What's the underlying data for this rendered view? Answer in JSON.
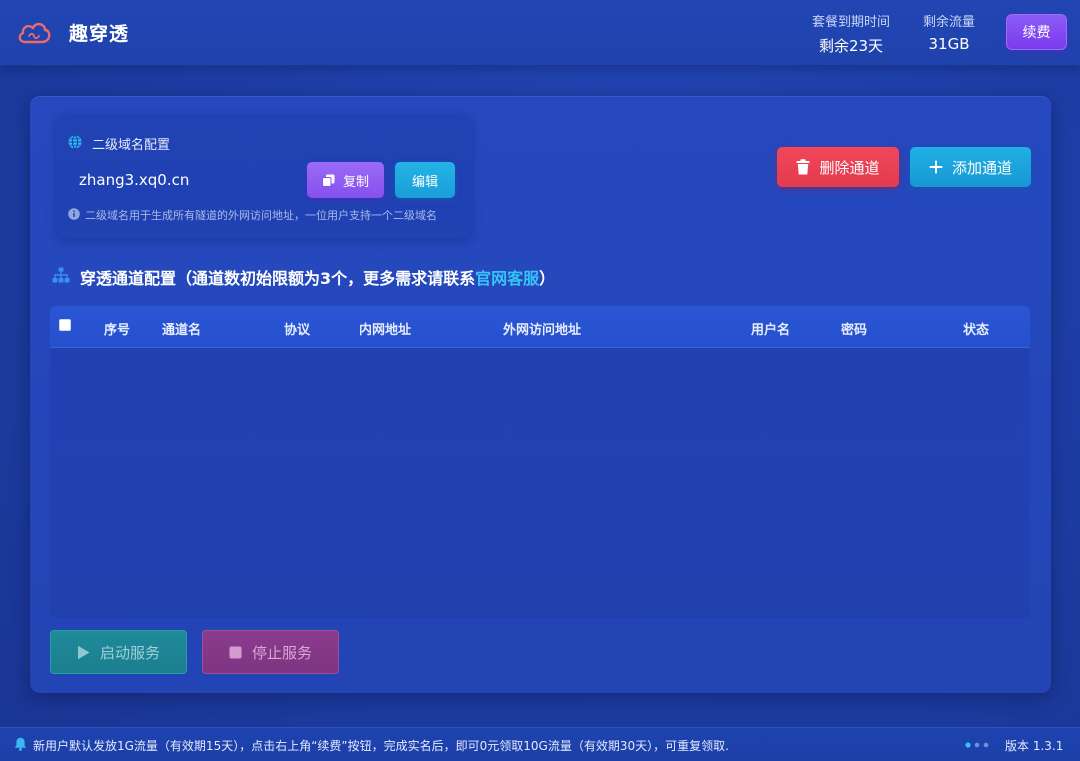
{
  "header": {
    "app_title": "趣穿透",
    "expire": {
      "label": "套餐到期时间",
      "value": "剩余23天"
    },
    "traffic": {
      "label": "剩余流量",
      "value": "31GB"
    },
    "renew_label": "续费"
  },
  "domain": {
    "title": "二级域名配置",
    "value": "zhang3.xq0.cn",
    "copy_label": "复制",
    "edit_label": "编辑",
    "note": "二级域名用于生成所有隧道的外网访问地址，一位用户支持一个二级域名"
  },
  "actions": {
    "delete_label": "删除通道",
    "add_label": "添加通道"
  },
  "section": {
    "title_prefix": "穿透通道配置（通道数初始限额为3个，更多需求请联系",
    "link_text": "官网客服",
    "title_suffix": "）"
  },
  "table": {
    "columns": [
      "序号",
      "通道名",
      "协议",
      "内网地址",
      "外网访问地址",
      "用户名",
      "密码",
      "状态"
    ],
    "rows": []
  },
  "service": {
    "start_label": "启动服务",
    "stop_label": "停止服务"
  },
  "statusbar": {
    "notice": "新用户默认发放1G流量（有效期15天），点击右上角“续费”按钮，完成实名后，即可0元领取10G流量（有效期30天），可重复领取.",
    "version": "版本 1.3.1"
  },
  "colors": {
    "accent_purple": "#8b5cf6",
    "accent_cyan": "#1fb0e4",
    "danger_red": "#f0475a",
    "link_cyan": "#37c3f5"
  }
}
